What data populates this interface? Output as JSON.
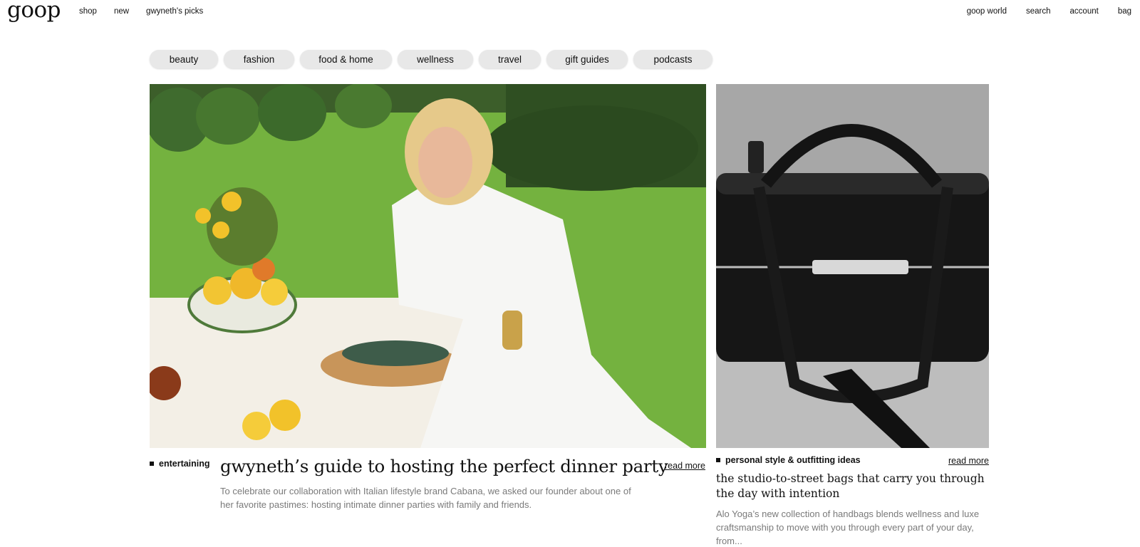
{
  "header": {
    "logo": "goop",
    "nav_left": [
      "shop",
      "new",
      "gwyneth's picks"
    ],
    "nav_right": [
      "goop world",
      "search",
      "account",
      "bag"
    ]
  },
  "categories": [
    "beauty",
    "fashion",
    "food & home",
    "wellness",
    "travel",
    "gift guides",
    "podcasts"
  ],
  "feature": {
    "tag": "entertaining",
    "headline": "gwyneth’s guide to hosting the perfect dinner party",
    "read_more": "read more",
    "dek": "To celebrate our collaboration with Italian lifestyle brand Cabana, we asked our founder about one of her favorite pastimes: hosting intimate dinner parties with family and friends."
  },
  "side": {
    "tag": "personal style & outfitting ideas",
    "read_more": "read more",
    "headline": "the studio-to-street bags that carry you through the day with intention",
    "dek": "Alo Yoga’s new collection of handbags blends wellness and luxe craftsmanship to move with you through every part of your day, from..."
  }
}
